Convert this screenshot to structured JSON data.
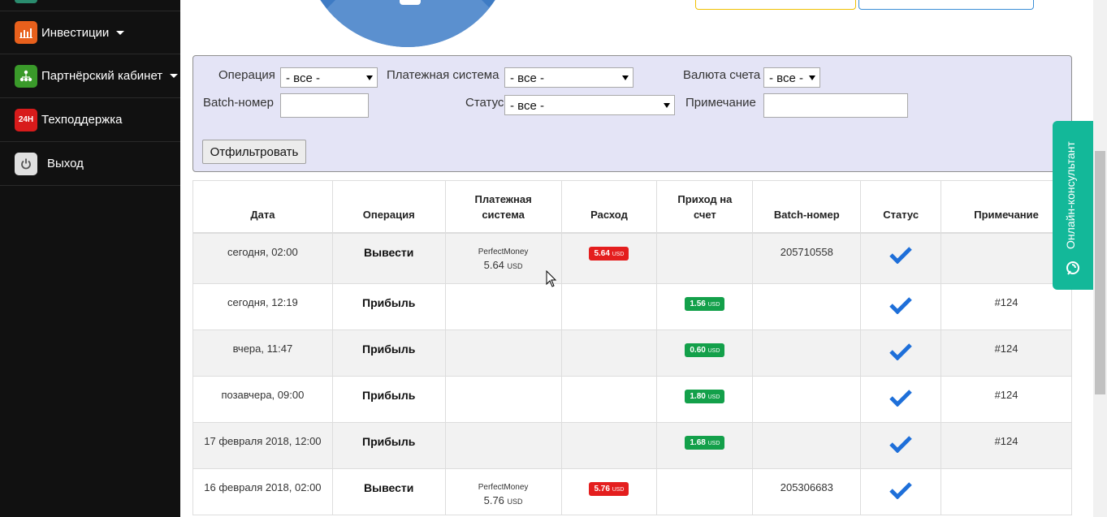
{
  "sidebar": {
    "items": [
      {
        "label": "Инвестиции",
        "icon": "investments-chart-icon",
        "color": "#e8601c",
        "has_caret": true
      },
      {
        "label": "Партнёрский кабинет",
        "icon": "partner-network-icon",
        "color": "#3a9a2a",
        "has_caret": true
      },
      {
        "label": "Техподдержка",
        "icon": "support-24h-icon",
        "color": "#d81b1b",
        "has_caret": false,
        "icon_text": "24H"
      },
      {
        "label": "Выход",
        "icon": "power-icon",
        "color": "#e0e0e0",
        "has_caret": false
      }
    ]
  },
  "filter": {
    "operation_label": "Операция",
    "operation_value": "- все -",
    "payment_system_label": "Платежная система",
    "payment_system_value": "- все -",
    "currency_label": "Валюта счета",
    "currency_value": "- все -",
    "batch_label": "Batch-номер",
    "batch_value": "",
    "status_label": "Статус",
    "status_value": "- все -",
    "note_label": "Примечание",
    "note_value": "",
    "submit_label": "Отфильтровать"
  },
  "table": {
    "headers": [
      "Дата",
      "Операция",
      "Платежная система",
      "Расход",
      "Приход на счет",
      "Batch-номер",
      "Статус",
      "Примечание"
    ],
    "rows": [
      {
        "date": "сегодня, 02:00",
        "operation": "Вывести",
        "ps_name": "PerfectMoney",
        "ps_amount": "5.64",
        "ps_currency": "USD",
        "expense": "5.64",
        "expense_currency": "USD",
        "income": "",
        "income_currency": "",
        "batch": "205710558",
        "note": ""
      },
      {
        "date": "сегодня, 12:19",
        "operation": "Прибыль",
        "ps_name": "",
        "ps_amount": "",
        "ps_currency": "",
        "expense": "",
        "expense_currency": "",
        "income": "1.56",
        "income_currency": "USD",
        "batch": "",
        "note": "#124"
      },
      {
        "date": "вчера, 11:47",
        "operation": "Прибыль",
        "ps_name": "",
        "ps_amount": "",
        "ps_currency": "",
        "expense": "",
        "expense_currency": "",
        "income": "0.60",
        "income_currency": "USD",
        "batch": "",
        "note": "#124"
      },
      {
        "date": "позавчера, 09:00",
        "operation": "Прибыль",
        "ps_name": "",
        "ps_amount": "",
        "ps_currency": "",
        "expense": "",
        "expense_currency": "",
        "income": "1.80",
        "income_currency": "USD",
        "batch": "",
        "note": "#124"
      },
      {
        "date": "17 февраля 2018, 12:00",
        "operation": "Прибыль",
        "ps_name": "",
        "ps_amount": "",
        "ps_currency": "",
        "expense": "",
        "expense_currency": "",
        "income": "1.68",
        "income_currency": "USD",
        "batch": "",
        "note": "#124"
      },
      {
        "date": "16 февраля 2018, 02:00",
        "operation": "Вывести",
        "ps_name": "PerfectMoney",
        "ps_amount": "5.76",
        "ps_currency": "USD",
        "expense": "5.76",
        "expense_currency": "USD",
        "income": "",
        "income_currency": "",
        "batch": "205306683",
        "note": ""
      }
    ]
  },
  "consultant": {
    "label": "Онлайн-консультант",
    "icon": "chat-bubble-icon"
  },
  "colors": {
    "sidebar_bg": "#111111",
    "filter_bg": "#e4e4f6",
    "expense_badge": "#e41e1e",
    "income_badge": "#13a04a",
    "check": "#1e6fd9",
    "consultant": "#13b899"
  }
}
